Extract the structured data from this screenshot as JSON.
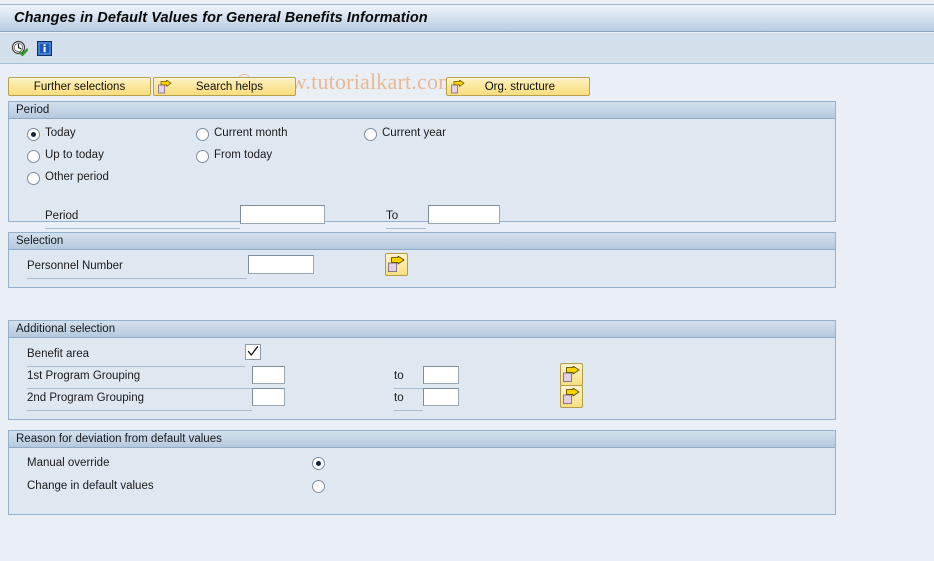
{
  "window": {
    "title": "Changes in Default Values for General Benefits Information"
  },
  "toolbar": {
    "icons": [
      {
        "name": "clock-check-icon",
        "title": "Execute with time"
      },
      {
        "name": "info-icon",
        "title": "Information"
      }
    ]
  },
  "watermark": {
    "text": "© www.tutorialkart.com",
    "color": "#e8b890"
  },
  "buttons": {
    "further_selections": "Further selections",
    "search_helps": "Search helps",
    "org_structure": "Org. structure"
  },
  "period": {
    "title": "Period",
    "options": [
      {
        "label": "Today",
        "selected": true
      },
      {
        "label": "Current month",
        "selected": false
      },
      {
        "label": "Current year",
        "selected": false
      },
      {
        "label": "Up to today",
        "selected": false
      },
      {
        "label": "From today",
        "selected": false
      },
      {
        "label": "Other period",
        "selected": false
      }
    ],
    "period_label": "Period",
    "period_value": "",
    "to_label": "To",
    "to_value": ""
  },
  "selection": {
    "title": "Selection",
    "personnel_number_label": "Personnel Number",
    "personnel_number_value": "",
    "multi_select_icon": "multiple-selection-arrow-icon"
  },
  "additional_selection": {
    "title": "Additional selection",
    "benefit_area_label": "Benefit area",
    "benefit_area_checked": true,
    "rows": [
      {
        "label": "1st Program Grouping",
        "from_value": "",
        "to_label": "to",
        "to_value": ""
      },
      {
        "label": "2nd Program Grouping",
        "from_value": "",
        "to_label": "to",
        "to_value": ""
      }
    ]
  },
  "reason": {
    "title": "Reason for deviation from default values",
    "options": [
      {
        "label": "Manual override",
        "selected": true
      },
      {
        "label": "Change in default values",
        "selected": false
      }
    ]
  },
  "colors": {
    "page_background": "#eaeff6",
    "group_body": "#dfe8f1",
    "group_header": "#c2d3e5",
    "group_border": "#95b0cb",
    "button_yellow": "#fbe79b",
    "titlebar_gradient_end": "#b9cde2"
  }
}
